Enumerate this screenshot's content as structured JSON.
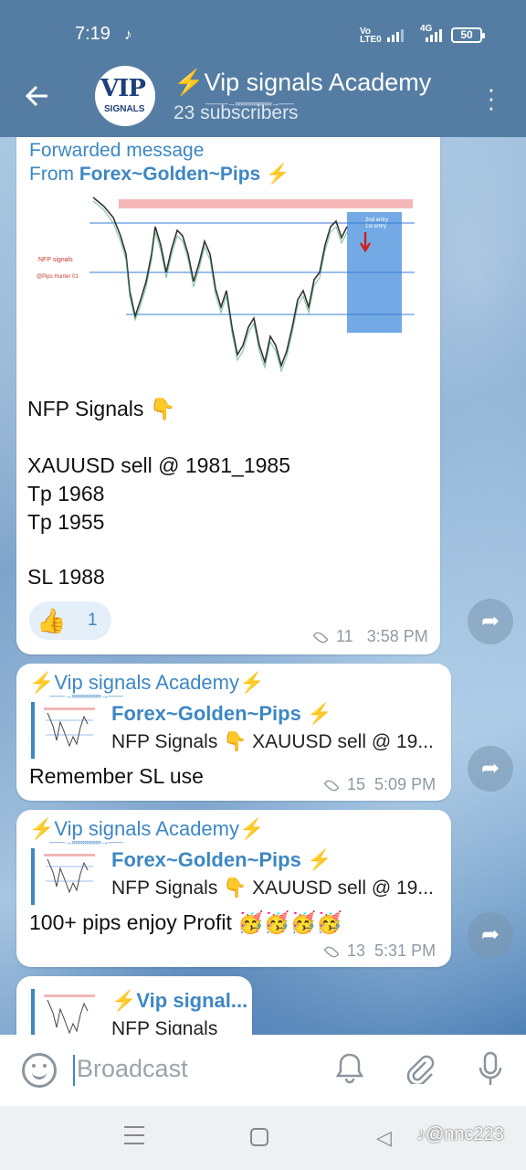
{
  "status": {
    "time": "7:19",
    "net_top": "Vo",
    "net_bottom": "LTE0",
    "net2": "4G",
    "battery": "50"
  },
  "header": {
    "title_bolt": "⚡",
    "title": "Vip signals Academy",
    "subtitle": "23 subscribers",
    "avatar_text": "VIP",
    "avatar_sub": "SIGNALS"
  },
  "messages": {
    "m1": {
      "fwd_label": "Forwarded message",
      "fwd_from": "From ",
      "fwd_name": "Forex~Golden~Pips ⚡",
      "chart_left1": "NFP signals",
      "chart_left2": "@Pips Hunter 01",
      "chart_label1": "2nd entry",
      "chart_label2": "1st entry",
      "text1": "NFP Signals 👇",
      "text2": "XAUUSD sell @ 1981_1985",
      "text3": "Tp 1968",
      "text4": "Tp 1955",
      "text5": "SL 1988",
      "reaction": "👍",
      "reaction_count": "1",
      "views": "11",
      "time": "3:58 PM"
    },
    "m2": {
      "sender": "⚡Vip signals Academy⚡",
      "reply_title": "Forex~Golden~Pips ⚡",
      "reply_snippet": "NFP Signals 👇  XAUUSD sell @ 19...",
      "text": "Remember SL use",
      "views": "15",
      "time": "5:09 PM"
    },
    "m3": {
      "sender": "⚡Vip signals Academy⚡",
      "reply_title": "Forex~Golden~Pips ⚡",
      "reply_snippet": "NFP Signals 👇  XAUUSD sell @ 19...",
      "text": "100+ pips enjoy Profit 🥳🥳🥳🥳",
      "views": "13",
      "time": "5:31 PM"
    },
    "m4": {
      "reply_title": "⚡Vip signal...",
      "reply_snippet": "NFP Signals"
    }
  },
  "composer": {
    "placeholder": "Broadcast"
  },
  "watermark": "♪@nnc223",
  "colors": {
    "header": "#557da3",
    "accent": "#3d87c4",
    "bolt": "#f5c21b"
  }
}
